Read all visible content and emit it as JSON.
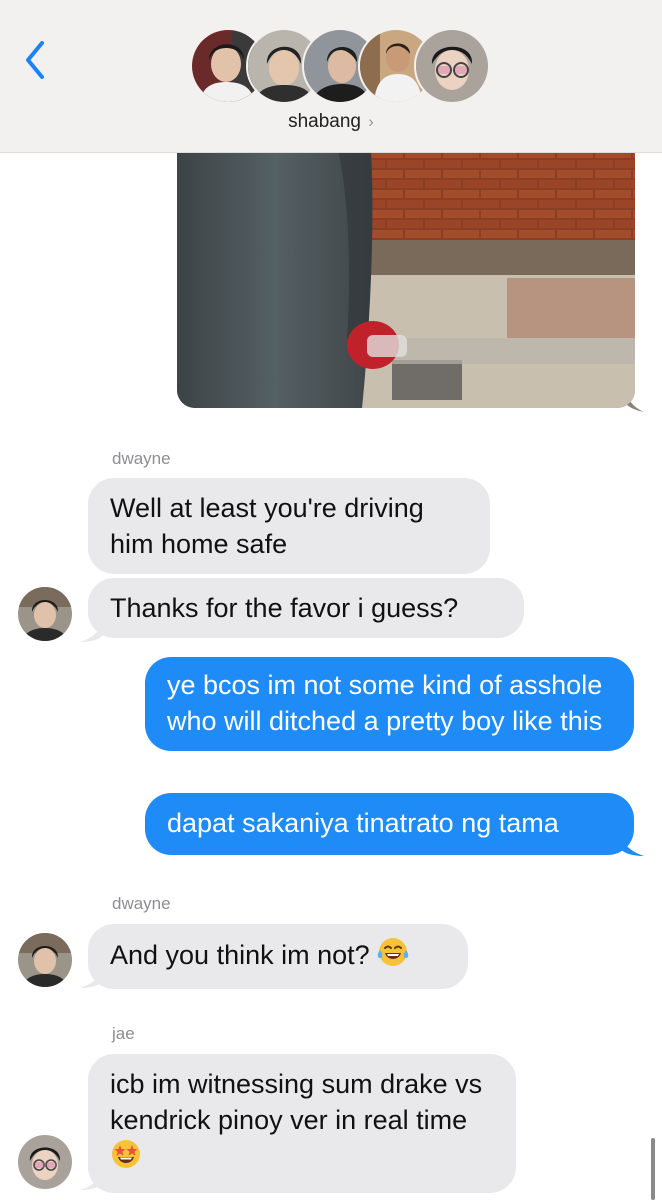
{
  "header": {
    "back_icon": "chevron-left-icon",
    "group_name": "shabang",
    "group_chevron": "›",
    "participants": [
      "member-1",
      "member-2",
      "member-3",
      "member-4",
      "member-5"
    ]
  },
  "messages": [
    {
      "type": "photo",
      "direction": "outgoing"
    },
    {
      "type": "sender",
      "name": "dwayne"
    },
    {
      "type": "text",
      "direction": "incoming",
      "text": "Well at least you're driving him home safe"
    },
    {
      "type": "text",
      "direction": "incoming",
      "text": "Thanks for the favor i guess?"
    },
    {
      "type": "text",
      "direction": "outgoing",
      "text": "ye bcos im not some kind of asshole who will ditched a pretty boy like this"
    },
    {
      "type": "text",
      "direction": "outgoing",
      "text": "dapat sakaniya tinatrato ng tama"
    },
    {
      "type": "sender",
      "name": "dwayne"
    },
    {
      "type": "text",
      "direction": "incoming",
      "text": "And you think im not?",
      "emoji": "face-with-tears-of-joy"
    },
    {
      "type": "sender",
      "name": "jae"
    },
    {
      "type": "text",
      "direction": "incoming",
      "text": "icb im witnessing sum drake vs kendrick pinoy ver in real time",
      "emoji": "star-struck"
    }
  ],
  "colors": {
    "outgoing_bubble": "#1f8bf7",
    "incoming_bubble": "#e9e9eb",
    "header_bg": "#f3f1ef",
    "accent": "#1a84f5"
  }
}
